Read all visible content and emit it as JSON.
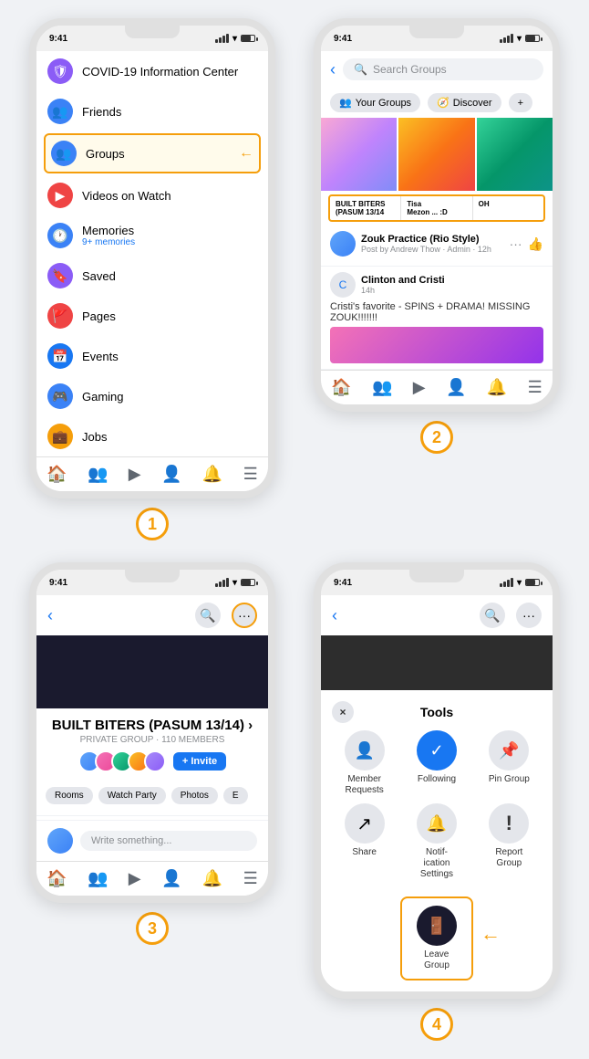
{
  "page": {
    "background": "#f0f2f5"
  },
  "phone1": {
    "time": "9:41",
    "menu_items": [
      {
        "id": "covid",
        "label": "COVID-19 Information Center",
        "icon": "🛡"
      },
      {
        "id": "friends",
        "label": "Friends",
        "icon": "👥"
      },
      {
        "id": "groups",
        "label": "Groups",
        "icon": "👥",
        "highlighted": true
      },
      {
        "id": "videos",
        "label": "Videos on Watch",
        "icon": "▶"
      },
      {
        "id": "memories",
        "label": "Memories",
        "icon": "🕐",
        "sub": "9+ memories"
      },
      {
        "id": "saved",
        "label": "Saved",
        "icon": "🔖"
      },
      {
        "id": "pages",
        "label": "Pages",
        "icon": "🚩"
      },
      {
        "id": "events",
        "label": "Events",
        "icon": "📅"
      },
      {
        "id": "gaming",
        "label": "Gaming",
        "icon": "🎮"
      },
      {
        "id": "jobs",
        "label": "Jobs",
        "icon": "💼"
      }
    ],
    "arrow_label": "←",
    "number": "1"
  },
  "phone2": {
    "time": "9:41",
    "search_placeholder": "Search Groups",
    "tabs": [
      "Your Groups",
      "Discover",
      "+"
    ],
    "groups": [
      {
        "name": "BUILT BITERS (PASUM 13/14",
        "short": "BUILT BITERS\n(PASUM 13/14"
      },
      {
        "name": "Tisa Mezon ... :D",
        "short": "Tisa\nMezon ... :D"
      },
      {
        "name": "OH",
        "short": "OH"
      }
    ],
    "posts": [
      {
        "name": "Zouk Practice (Rio Style)",
        "sub": "Post by Andrew Thow · Admin · 12h",
        "text": ""
      },
      {
        "name": "Clinton and Cristi",
        "sub": "14h",
        "text": "Cristi's favorite - SPINS + DRAMA!\nMISSING ZOUK!!!!!!!"
      }
    ],
    "number": "2"
  },
  "phone3": {
    "time": "9:41",
    "group_name": "BUILT BITERS (PASUM 13/14) ›",
    "group_type": "PRIVATE GROUP · 110 MEMBERS",
    "invite_label": "+ Invite",
    "action_tabs": [
      "Rooms",
      "Watch Party",
      "Photos",
      "E"
    ],
    "write_placeholder": "Write something...",
    "number": "3"
  },
  "phone4": {
    "time": "9:41",
    "tools_title": "Tools",
    "close_label": "×",
    "tools": [
      {
        "id": "member-requests",
        "label": "Member\nRequests",
        "icon": "👤",
        "active": false
      },
      {
        "id": "following",
        "label": "Following",
        "icon": "✓",
        "active": true
      },
      {
        "id": "pin-group",
        "label": "Pin Group",
        "icon": "📌",
        "active": false
      },
      {
        "id": "share",
        "label": "Share",
        "icon": "↗",
        "active": false
      },
      {
        "id": "notification-settings",
        "label": "Notif-\nication\nSettings",
        "icon": "🔔",
        "active": false
      },
      {
        "id": "report-group",
        "label": "Report\nGroup",
        "icon": "!",
        "active": false
      }
    ],
    "leave_label": "Leave\nGroup",
    "leave_icon": "🚪",
    "number": "4"
  }
}
